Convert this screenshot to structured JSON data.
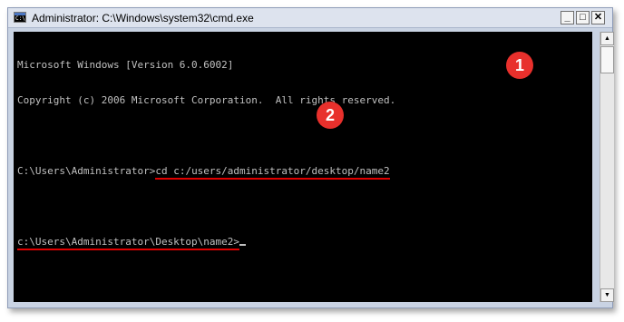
{
  "window": {
    "title": "Administrator: C:\\Windows\\system32\\cmd.exe",
    "icon_label": "C:\\",
    "controls": {
      "minimize": "_",
      "maximize": "□",
      "close": "✕"
    }
  },
  "console": {
    "line1": "Microsoft Windows [Version 6.0.6002]",
    "line2": "Copyright (c) 2006 Microsoft Corporation.  All rights reserved.",
    "prompt1": "C:\\Users\\Administrator>",
    "command1": "cd c:/users/administrator/desktop/name2",
    "prompt2": "c:\\Users\\Administrator\\Desktop\\name2>"
  },
  "annotations": {
    "badge1": "1",
    "badge2": "2",
    "color": "#e8302c",
    "underline_color": "#e00000"
  },
  "scrollbar": {
    "up_arrow": "▲",
    "down_arrow": "▼"
  }
}
